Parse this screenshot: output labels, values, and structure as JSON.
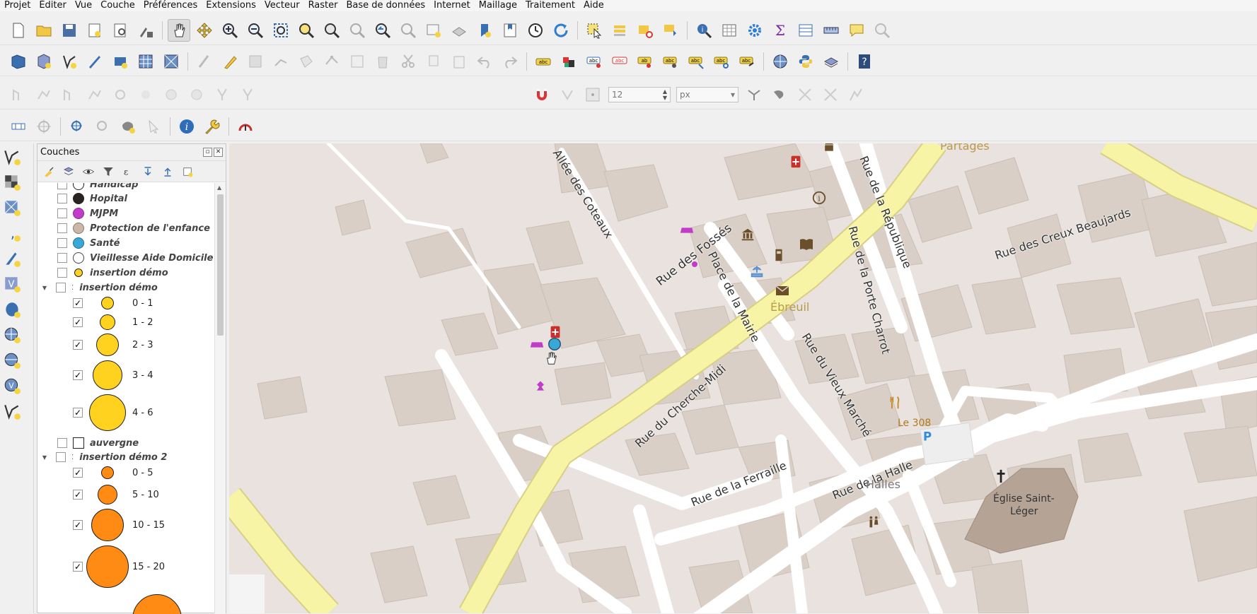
{
  "menu": [
    "Projet",
    "Éditer",
    "Vue",
    "Couche",
    "Préférences",
    "Extensions",
    "Vecteur",
    "Raster",
    "Base de données",
    "Internet",
    "Maillage",
    "Traitement",
    "Aide"
  ],
  "snapping": {
    "tolerance": "12",
    "unit": "px"
  },
  "layers_panel": {
    "title": "Couches",
    "layers": [
      {
        "name": "Handicap",
        "color": "#555555",
        "checked": false
      },
      {
        "name": "Hopital",
        "color": "#2b2320",
        "checked": false
      },
      {
        "name": "MJPM",
        "color": "#c03cc9",
        "checked": false
      },
      {
        "name": "Protection de l'enfance",
        "color": "#c9b8a8",
        "checked": false
      },
      {
        "name": "Santé",
        "color": "#3aa8d6",
        "checked": false
      },
      {
        "name": "Vieillesse Aide Domicile",
        "color": "#ffffff",
        "checked": false
      },
      {
        "name": "insertion démo",
        "color": "#ffd21f",
        "checked": false
      }
    ],
    "group1": {
      "name": "insertion démo",
      "color": "#ffd21f",
      "classes": [
        "0 - 1",
        "1 - 2",
        "2 - 3",
        "3 - 4",
        "4 - 6"
      ]
    },
    "auvergne": {
      "name": "auvergne",
      "checked": false
    },
    "group2": {
      "name": "insertion démo 2",
      "color": "#ff8a14",
      "classes": [
        "0 - 5",
        "5 - 10",
        "10 - 15",
        "15 - 20"
      ]
    }
  },
  "map": {
    "streets": {
      "fosses": "Rue des Fossés",
      "coteaux": "Allée des Coteaux",
      "republique": "Rue de la République",
      "creux": "Rue des Creux Beaujards",
      "mairie": "Place de la Mairie",
      "porte": "Rue de la Porte Charrot",
      "vieux": "Rue du Vieux Marché",
      "cherche": "Rue du Cherche-Midi",
      "ferraille": "Rue de la Ferraille",
      "halle": "Rue de la Halle"
    },
    "places": {
      "partages": "Partages",
      "ebreuil": "Ébreuil",
      "le308": "Le 308",
      "halles": "Halles",
      "eglise1": "Église Saint-",
      "eglise2": "Léger"
    },
    "colors": {
      "major_road": "#f7f4a6",
      "road_casing": "#d8cf84",
      "building": "#d9cfc6",
      "church": "#b5a496"
    }
  }
}
